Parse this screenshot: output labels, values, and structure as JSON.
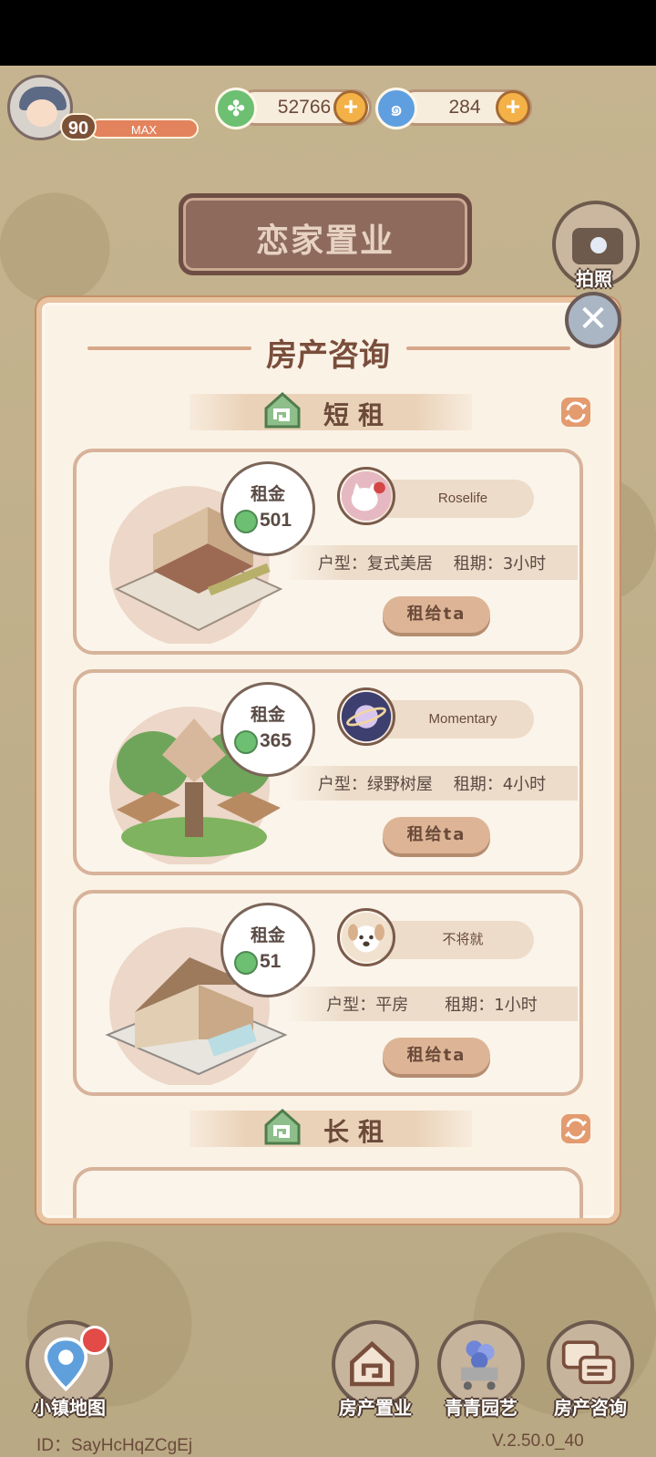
{
  "player": {
    "level": "90",
    "level_status": "MAX"
  },
  "currencies": {
    "clover": "52766",
    "swirl": "284"
  },
  "header": {
    "title": "恋家置业",
    "camera_label": "拍照"
  },
  "panel": {
    "title": "房产咨询",
    "short_section": "短租",
    "long_section": "长租",
    "listings": [
      {
        "rent_label": "租金",
        "rent": "501",
        "owner": "Roselife",
        "info": "户型：复式美居    租期：3小时",
        "button": "租给ta"
      },
      {
        "rent_label": "租金",
        "rent": "365",
        "owner": "Momentary",
        "info": "户型：绿野树屋    租期：4小时",
        "button": "租给ta"
      },
      {
        "rent_label": "租金",
        "rent": "51",
        "owner": "不将就",
        "info": "户型：平房       租期：1小时",
        "button": "租给ta"
      }
    ]
  },
  "nav": {
    "map": "小镇地图",
    "property": "房产置业",
    "garden": "青青园艺",
    "consult": "房产咨询"
  },
  "footer": {
    "id": "ID：SayHcHqZCgEj",
    "version": "V.2.50.0_40"
  },
  "colors": {
    "clover": "#6dbf71",
    "swirl": "#5f9fe0",
    "accent": "#e2835d"
  }
}
